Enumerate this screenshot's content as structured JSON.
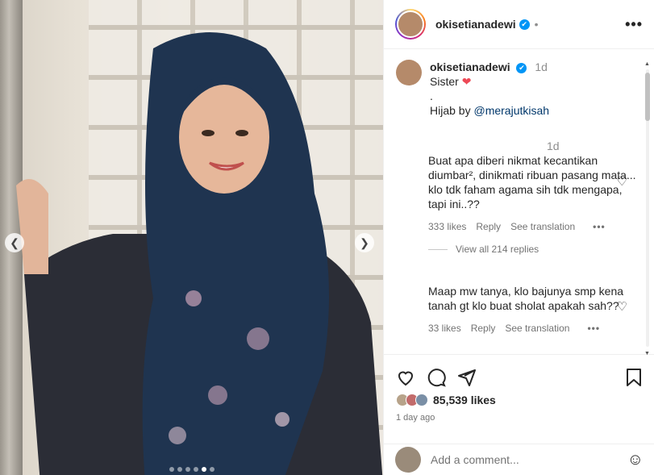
{
  "post": {
    "username": "okisetianadewi",
    "verified_mark": "✔",
    "more_label": "•••",
    "caption": {
      "username": "okisetianadewi",
      "time": "1d",
      "line1": "Sister",
      "line2": ".",
      "line3_prefix": "Hijab by",
      "mention": "@merajutkisah"
    },
    "comments": [
      {
        "time": "1d",
        "text": "Buat apa diberi nikmat kecantikan diumbar², dinikmati ribuan pasang mata... klo tdk faham agama sih tdk mengapa, tapi ini..??",
        "likes": "333 likes",
        "reply": "Reply",
        "translate": "See translation",
        "view_replies": "View all 214 replies"
      },
      {
        "text": "Maap mw tanya, klo bajunya smp kena tanah gt klo buat sholat apakah sah??",
        "likes": "33 likes",
        "reply": "Reply",
        "translate": "See translation"
      }
    ],
    "likes_count": "85,539 likes",
    "posted_ago": "1 day ago",
    "add_comment_placeholder": "Add a comment...",
    "icons": {
      "like": "heart-icon",
      "comment": "comment-icon",
      "share": "share-icon",
      "save": "bookmark-icon",
      "emoji": "emoji-icon"
    },
    "carousel": {
      "total": 6,
      "active": 5
    }
  }
}
